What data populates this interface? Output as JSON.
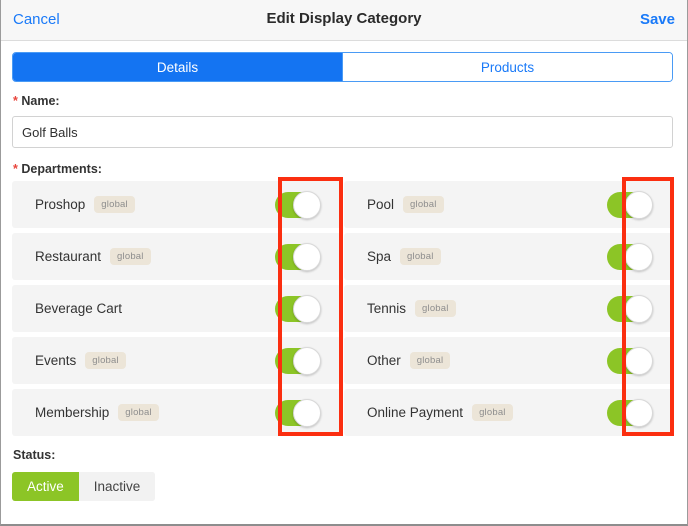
{
  "header": {
    "cancel_label": "Cancel",
    "title": "Edit Display Category",
    "save_label": "Save"
  },
  "tabs": [
    {
      "label": "Details",
      "active": true
    },
    {
      "label": "Products",
      "active": false
    }
  ],
  "form": {
    "name_label": "Name:",
    "name_required": "*",
    "name_value": "Golf Balls",
    "name_placeholder": "Name",
    "departments_label": "Departments:",
    "departments_required": "*",
    "status_label": "Status:"
  },
  "departments": [
    {
      "name": "Proshop",
      "badge": "global",
      "enabled": true
    },
    {
      "name": "Pool",
      "badge": "global",
      "enabled": true
    },
    {
      "name": "Restaurant",
      "badge": "global",
      "enabled": true
    },
    {
      "name": "Spa",
      "badge": "global",
      "enabled": true
    },
    {
      "name": "Beverage Cart",
      "badge": "",
      "enabled": true
    },
    {
      "name": "Tennis",
      "badge": "global",
      "enabled": true
    },
    {
      "name": "Events",
      "badge": "global",
      "enabled": true
    },
    {
      "name": "Other",
      "badge": "global",
      "enabled": true
    },
    {
      "name": "Membership",
      "badge": "global",
      "enabled": true
    },
    {
      "name": "Online Payment",
      "badge": "global",
      "enabled": true
    }
  ],
  "status_options": [
    {
      "label": "Active",
      "active": true
    },
    {
      "label": "Inactive",
      "active": false
    }
  ],
  "colors": {
    "accent_blue": "#1474f2",
    "link_blue": "#1a7af8",
    "toggle_green": "#8cc526",
    "badge_bg": "#ece5d8",
    "annotation_red": "#fb2e10",
    "required_red": "#e8453c",
    "row_bg": "#f4f4f4"
  }
}
